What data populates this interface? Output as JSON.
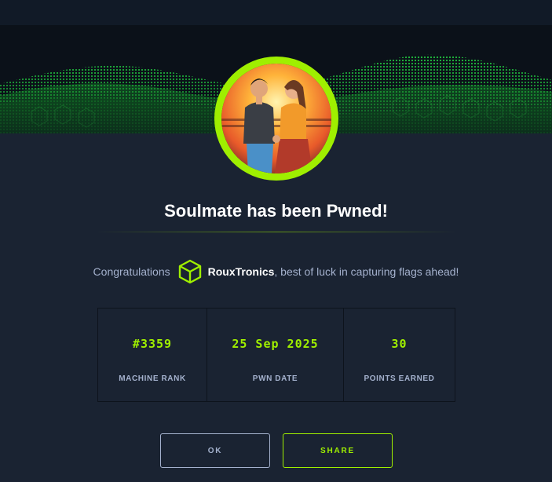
{
  "modal": {
    "title": "Soulmate has been Pwned!",
    "congrats_prefix": "Congratulations",
    "username": "RouxTronics",
    "congrats_suffix": ", best of luck in capturing flags ahead!"
  },
  "stats": [
    {
      "value": "#3359",
      "label": "MACHINE RANK"
    },
    {
      "value": "25 Sep 2025",
      "label": "PWN DATE"
    },
    {
      "value": "30",
      "label": "POINTS EARNED"
    }
  ],
  "buttons": {
    "ok_label": "OK",
    "share_label": "SHARE"
  },
  "colors": {
    "accent": "#9fef00",
    "background": "#1a2332",
    "muted_text": "#a4b1cd"
  },
  "icons": {
    "user_badge": "cube-icon",
    "avatar": "couple-at-sunset-avatar"
  }
}
